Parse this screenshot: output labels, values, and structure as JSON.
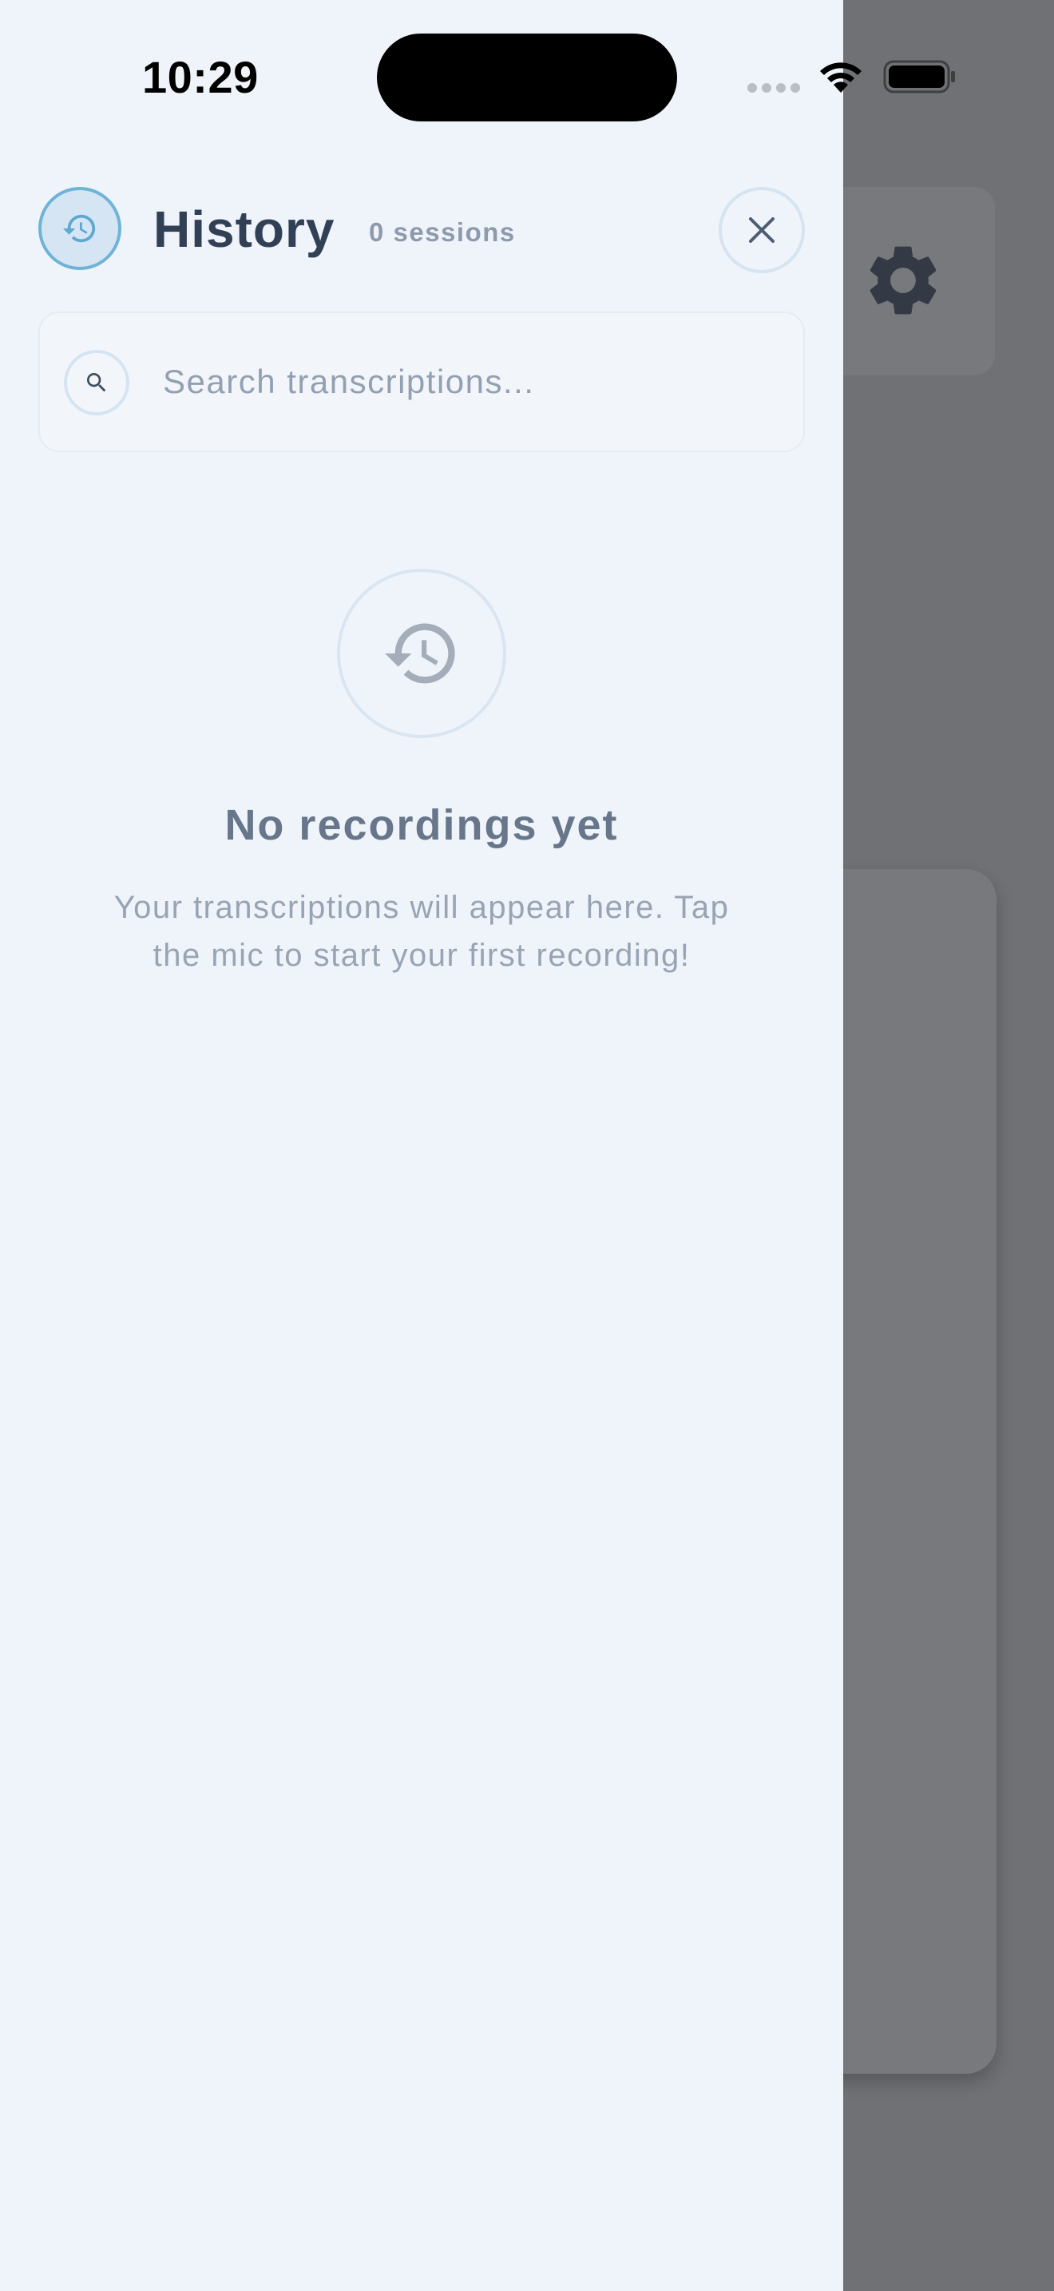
{
  "status_bar": {
    "time": "10:29"
  },
  "background_app": {
    "settings_icon": "gear-icon"
  },
  "drawer": {
    "header": {
      "icon": "history-icon",
      "title": "History",
      "session_count": "0 sessions",
      "close_icon": "close-icon"
    },
    "search": {
      "icon": "search-icon",
      "placeholder": "Search transcriptions...",
      "value": ""
    },
    "empty_state": {
      "icon": "history-icon",
      "title": "No recordings yet",
      "description": "Your transcriptions will appear here. Tap the mic to start your first recording!"
    }
  },
  "colors": {
    "drawer_background": "#eff4fa",
    "accent": "#6fb4d6",
    "title_text": "#324056",
    "muted_text": "#98a4b4",
    "overlay": "#6f7174"
  }
}
